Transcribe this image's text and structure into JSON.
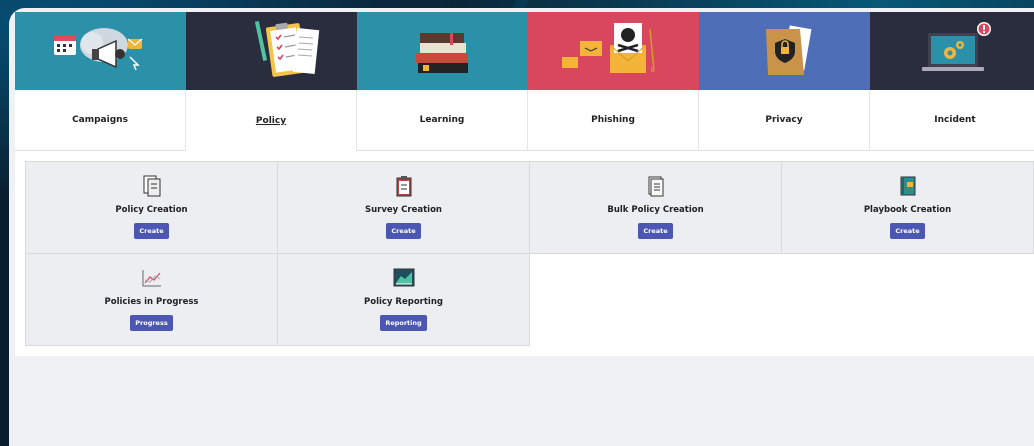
{
  "tabs": [
    {
      "label": "Campaigns",
      "bg": "#2b91a8",
      "icon": "campaign-icon"
    },
    {
      "label": "Policy",
      "bg": "#2a2d3d",
      "icon": "policy-clipboard-icon",
      "active": true
    },
    {
      "label": "Learning",
      "bg": "#2b91a8",
      "icon": "books-icon"
    },
    {
      "label": "Phishing",
      "bg": "#d9475f",
      "icon": "phishing-envelope-icon"
    },
    {
      "label": "Privacy",
      "bg": "#4f6eb8",
      "icon": "privacy-folder-icon"
    },
    {
      "label": "Incident",
      "bg": "#2a2d3d",
      "icon": "incident-laptop-icon"
    }
  ],
  "cards": [
    {
      "title": "Policy Creation",
      "button": "Create",
      "icon": "policy-document-icon"
    },
    {
      "title": "Survey Creation",
      "button": "Create",
      "icon": "survey-clipboard-icon"
    },
    {
      "title": "Bulk Policy Creation",
      "button": "Create",
      "icon": "bulk-document-icon"
    },
    {
      "title": "Playbook Creation",
      "button": "Create",
      "icon": "playbook-book-icon"
    },
    {
      "title": "Policies in Progress",
      "button": "Progress",
      "icon": "progress-chart-icon"
    },
    {
      "title": "Policy Reporting",
      "button": "Reporting",
      "icon": "reporting-chart-icon"
    }
  ],
  "colors": {
    "accent_button": "#4b57b3"
  }
}
